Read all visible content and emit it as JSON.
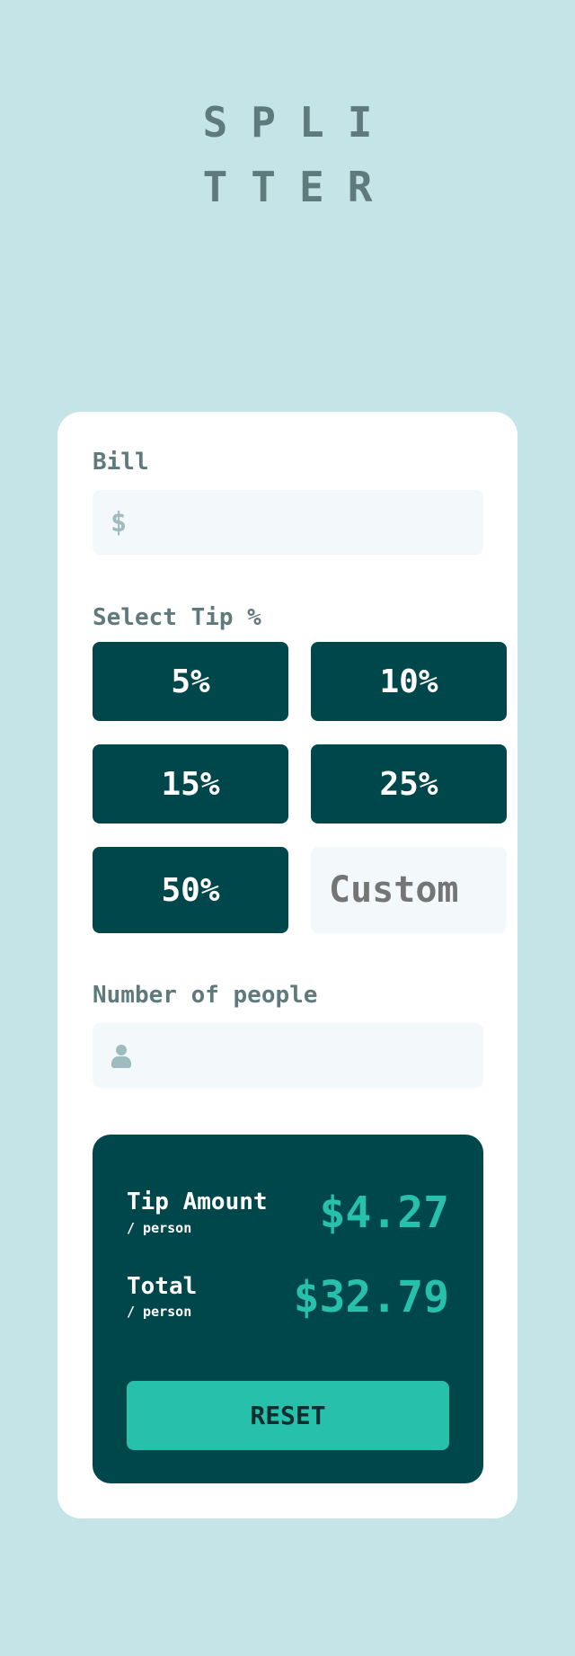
{
  "logo": {
    "line1": "SPLI",
    "line2": "TTER"
  },
  "bill": {
    "label": "Bill",
    "currency_symbol": "$",
    "value": ""
  },
  "tip": {
    "label": "Select Tip %",
    "options": [
      "5%",
      "10%",
      "15%",
      "25%",
      "50%"
    ],
    "custom_placeholder": "Custom"
  },
  "people": {
    "label": "Number of people",
    "value": "",
    "icon": "person-icon"
  },
  "results": {
    "tip_amount": {
      "label": "Tip Amount",
      "sublabel": "/ person",
      "value": "$4.27"
    },
    "total": {
      "label": "Total",
      "sublabel": "/ person",
      "value": "$32.79"
    },
    "reset_label": "RESET"
  },
  "colors": {
    "background": "#c5e4e7",
    "dark_cyan": "#00474b",
    "strong_cyan": "#26c0ab",
    "grayish_cyan": "#5e7a7d",
    "input_bg": "#f3f9fa"
  }
}
